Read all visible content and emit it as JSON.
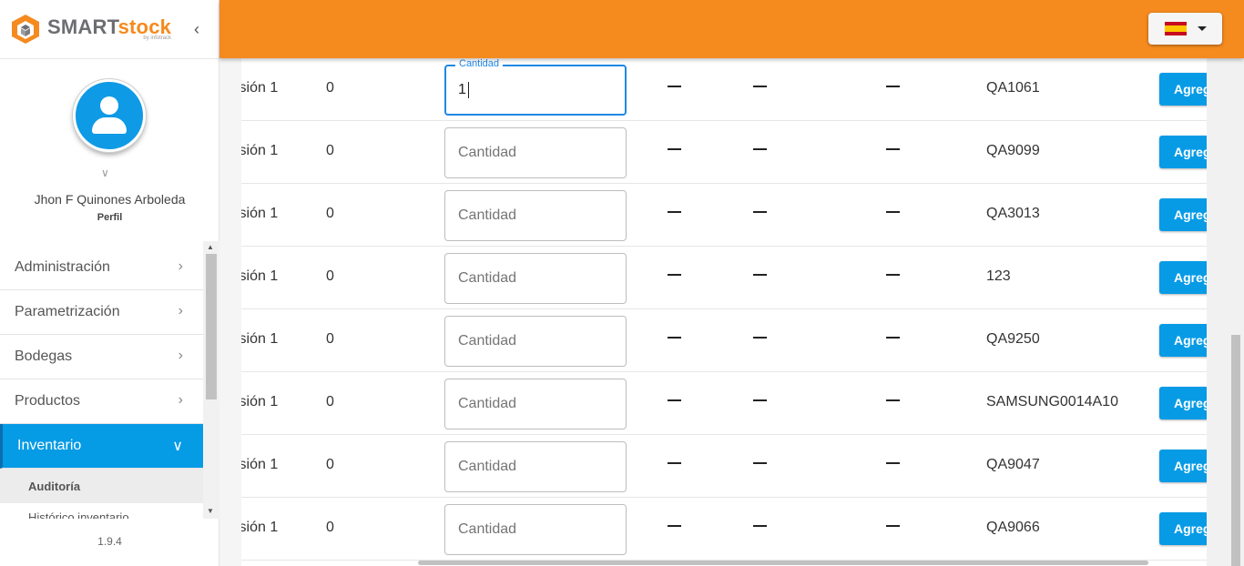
{
  "brand": {
    "name_part1": "SMART",
    "name_part2": "stock",
    "sub": "by infotrack"
  },
  "profile": {
    "name": "Jhon F Quinones Arboleda",
    "link": "Perfil"
  },
  "menu": [
    {
      "label": "Administración"
    },
    {
      "label": "Parametrización"
    },
    {
      "label": "Bodegas"
    },
    {
      "label": "Productos"
    },
    {
      "label": "Inventario"
    }
  ],
  "submenu": [
    {
      "label": "Auditoría"
    },
    {
      "label": "Histórico inventario"
    }
  ],
  "version": "1.9.4",
  "table": {
    "qty_placeholder": "Cantidad",
    "focused_label": "Cantidad",
    "focused_value": "1",
    "add_label": "Agregar",
    "rows": [
      {
        "division": "isión 1",
        "count": "0",
        "code": "QA1061"
      },
      {
        "division": "isión 1",
        "count": "0",
        "code": "QA9099"
      },
      {
        "division": "isión 1",
        "count": "0",
        "code": "QA3013"
      },
      {
        "division": "isión 1",
        "count": "0",
        "code": "123"
      },
      {
        "division": "isión 1",
        "count": "0",
        "code": "QA9250"
      },
      {
        "division": "isión 1",
        "count": "0",
        "code": "SAMSUNG0014A10"
      },
      {
        "division": "isión 1",
        "count": "0",
        "code": "QA9047"
      },
      {
        "division": "isión 1",
        "count": "0",
        "code": "QA9066"
      }
    ]
  },
  "colors": {
    "topbar": "#f58a1f",
    "accent": "#069be5"
  }
}
